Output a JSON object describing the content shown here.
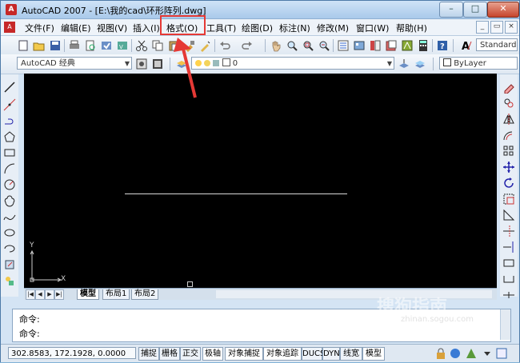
{
  "window": {
    "title": "AutoCAD 2007 - [E:\\我的cad\\环形阵列.dwg]"
  },
  "menu": {
    "items": [
      "文件(F)",
      "编辑(E)",
      "视图(V)",
      "插入(I)",
      "格式(O)",
      "工具(T)",
      "绘图(D)",
      "标注(N)",
      "修改(M)",
      "窗口(W)",
      "帮助(H)"
    ]
  },
  "toolbar": {
    "text_style": "Standard",
    "workspace": "AutoCAD 经典",
    "layer": "0",
    "color": "ByLayer"
  },
  "canvas": {
    "ucs_x": "X",
    "ucs_y": "Y"
  },
  "tabs": [
    "模型",
    "布局1",
    "布局2"
  ],
  "command": {
    "line1": "命令:",
    "line2": "命令:"
  },
  "status": {
    "coords": "302.8583,  172.1928,  0.0000",
    "buttons": [
      "捕捉",
      "栅格",
      "正交",
      "极轴",
      "对象捕捉",
      "对象追踪",
      "DUCS",
      "DYN",
      "线宽",
      "模型"
    ]
  },
  "watermark": {
    "text": "搜狗指南",
    "url": "zhinan.sogou.com"
  },
  "colors": {
    "highlight": "#e53935",
    "canvas": "#000000"
  }
}
